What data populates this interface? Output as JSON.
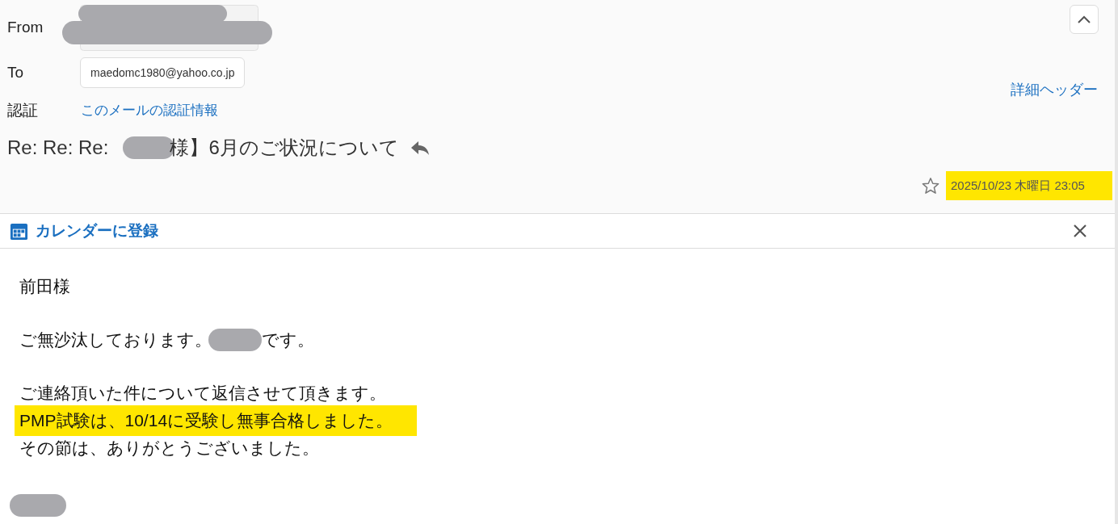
{
  "header": {
    "from": {
      "label": "From"
    },
    "to": {
      "label": "To",
      "value": "maedomc1980@yahoo.co.jp"
    },
    "auth": {
      "label": "認証",
      "link": "このメールの認証情報"
    },
    "details_link": "詳細ヘッダー",
    "subject": {
      "prefix": "Re: Re: Re:",
      "rest": "様】6月のご状況について"
    },
    "starred": false,
    "date": {
      "text": "2025/10/23 木曜日 23:05",
      "highlighted": true
    }
  },
  "calendar_bar": {
    "label": "カレンダーに登録"
  },
  "body": {
    "paragraphs": [
      [
        {
          "text": "前田様",
          "highlighted": false
        }
      ],
      [
        {
          "text": "ご無沙汰しております。",
          "text_after": "です。",
          "highlighted": false
        }
      ],
      [
        {
          "text": "ご連絡頂いた件について返信させて頂きます。",
          "highlighted": false
        },
        {
          "text": "PMP試験は、10/14に受験し無事合格しました。",
          "highlighted": true
        },
        {
          "text": "その節は、ありがとうございました。",
          "highlighted": false
        }
      ]
    ]
  }
}
